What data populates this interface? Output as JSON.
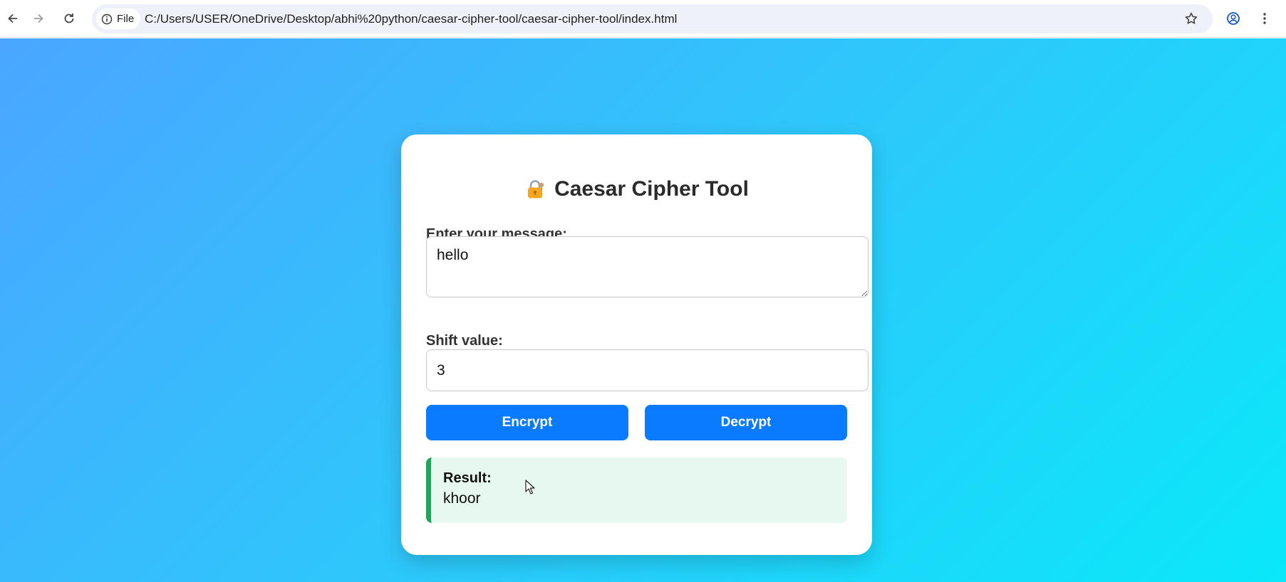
{
  "browser": {
    "site_chip_label": "File",
    "url": "C:/Users/USER/OneDrive/Desktop/abhi%20python/caesar-cipher-tool/caesar-cipher-tool/index.html",
    "icons": [
      "back-arrow-icon",
      "forward-arrow-icon",
      "reload-icon",
      "info-icon",
      "star-icon",
      "profile-icon",
      "more-vert-icon"
    ]
  },
  "page": {
    "gradient_start": "#4aa6ff",
    "gradient_end": "#0ae8fa"
  },
  "card": {
    "title": "Caesar Cipher Tool",
    "title_icon": "lock-key-icon",
    "message_label": "Enter your message:",
    "message_value": "hello",
    "shift_label": "Shift value:",
    "shift_value": "3",
    "encrypt_label": "Encrypt",
    "decrypt_label": "Decrypt",
    "button_color": "#0a7bff",
    "result_label": "Result:",
    "result_value": "khoor",
    "result_accent": "#22a55a"
  }
}
